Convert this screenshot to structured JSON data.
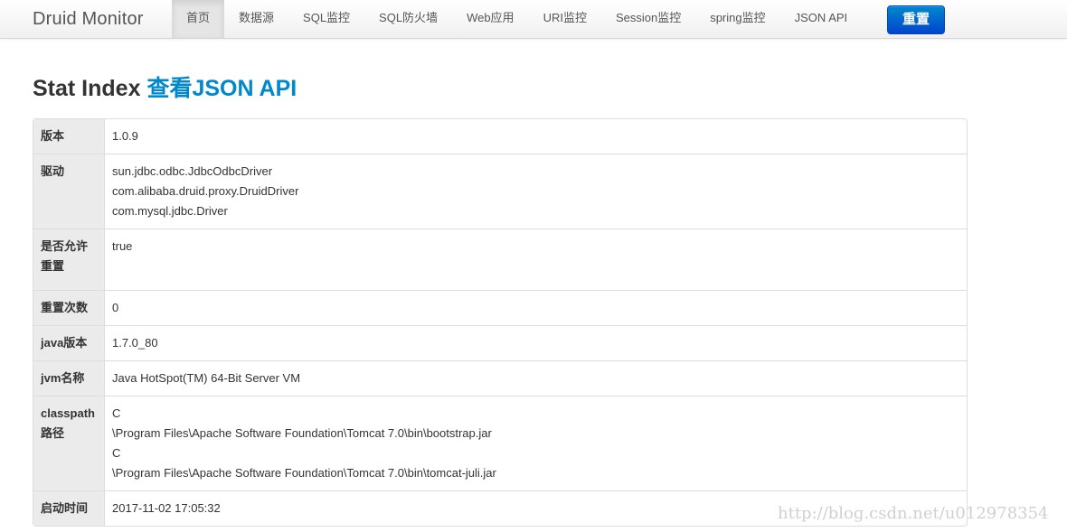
{
  "navbar": {
    "brand": "Druid Monitor",
    "items": [
      {
        "label": "首页",
        "active": true
      },
      {
        "label": "数据源"
      },
      {
        "label": "SQL监控"
      },
      {
        "label": "SQL防火墙"
      },
      {
        "label": "Web应用"
      },
      {
        "label": "URI监控"
      },
      {
        "label": "Session监控"
      },
      {
        "label": "spring监控"
      },
      {
        "label": "JSON API"
      }
    ],
    "reset_button": "重置"
  },
  "page": {
    "title": "Stat Index",
    "json_link": "查看JSON API"
  },
  "stats": {
    "version": {
      "key": "版本",
      "value": "1.0.9"
    },
    "drivers": {
      "key": "驱动",
      "lines": [
        "sun.jdbc.odbc.JdbcOdbcDriver",
        "com.alibaba.druid.proxy.DruidDriver",
        "com.mysql.jdbc.Driver"
      ]
    },
    "reset_enable": {
      "key_line1": "是否允许",
      "key_line2": "重置",
      "value": "true"
    },
    "reset_count": {
      "key": "重置次数",
      "value": "0"
    },
    "java_version": {
      "key": "java版本",
      "value": "1.7.0_80"
    },
    "jvm_name": {
      "key": "jvm名称",
      "value": "Java HotSpot(TM) 64-Bit Server VM"
    },
    "classpath": {
      "key_line1": "classpath",
      "key_line2": "路径",
      "lines": [
        "C",
        "\\Program Files\\Apache Software Foundation\\Tomcat 7.0\\bin\\bootstrap.jar",
        "C",
        "\\Program Files\\Apache Software Foundation\\Tomcat 7.0\\bin\\tomcat-juli.jar"
      ]
    },
    "start_time": {
      "key": "启动时间",
      "value": "2017-11-02 17:05:32"
    }
  },
  "watermark": "http://blog.csdn.net/u012978354",
  "colors": {
    "accent": "#0088cc",
    "button": "#0055cc",
    "key_bg": "#ebebeb"
  }
}
